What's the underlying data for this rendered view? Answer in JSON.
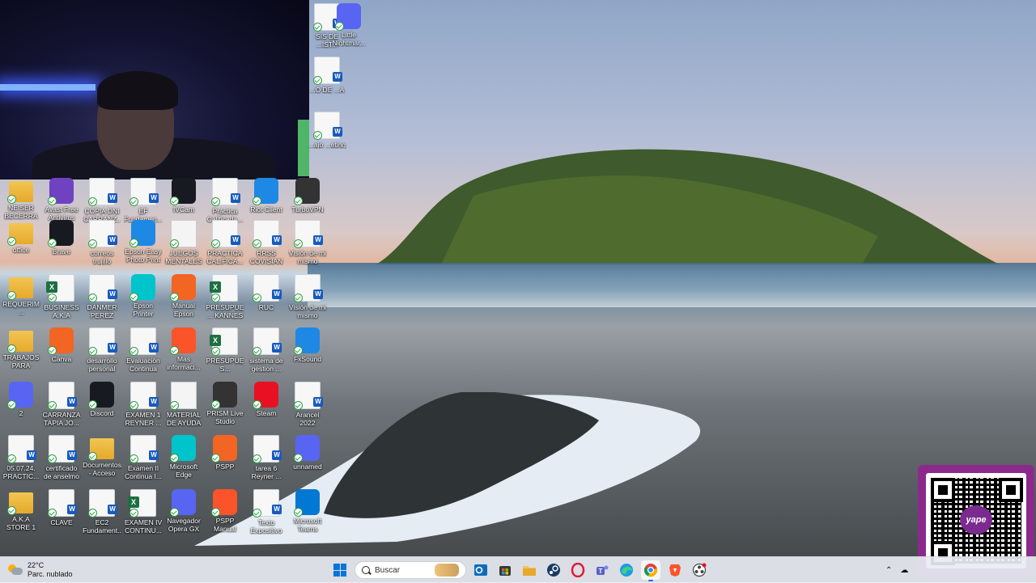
{
  "desktop": {
    "columns": [
      {
        "col": 0,
        "items": [
          {
            "label": "NEISER BECERRA C...",
            "type": "folder"
          },
          {
            "label": "office",
            "type": "folder"
          },
          {
            "label": "REQUERIM... TRUJILLO",
            "type": "folder"
          },
          {
            "label": "TRABAJOS PARA POW...",
            "type": "folder"
          },
          {
            "label": "2",
            "type": "app"
          },
          {
            "label": "05.07.24. PRACTIC...",
            "type": "doc"
          },
          {
            "label": "A.K.A STORE 1",
            "type": "folder"
          }
        ]
      },
      {
        "col": 1,
        "items": [
          {
            "label": "Avast Free Antivirus",
            "type": "app"
          },
          {
            "label": "Brave",
            "type": "app"
          },
          {
            "label": "BUSINESS A.K.A",
            "type": "xls"
          },
          {
            "label": "Canva",
            "type": "app"
          },
          {
            "label": "CARRANZA TAPIA JO...",
            "type": "doc"
          },
          {
            "label": "certificado de anselmo",
            "type": "doc"
          },
          {
            "label": "CLAVE",
            "type": "doc"
          }
        ]
      },
      {
        "col": 2,
        "items": [
          {
            "label": "COPIA DNI CARRANZ...",
            "type": "doc"
          },
          {
            "label": "correos trujillo",
            "type": "doc"
          },
          {
            "label": "DANMER PEREZ CA...",
            "type": "doc"
          },
          {
            "label": "desarrollo personal",
            "type": "doc"
          },
          {
            "label": "Discord",
            "type": "app"
          },
          {
            "label": "Documentos - Acceso di...",
            "type": "folder"
          },
          {
            "label": "EC2 Fundament...",
            "type": "doc"
          }
        ]
      },
      {
        "col": 3,
        "items": [
          {
            "label": "EF Fundamen...",
            "type": "doc"
          },
          {
            "label": "Epson Easy Photo Print",
            "type": "app"
          },
          {
            "label": "Epson Printer Connectio...",
            "type": "app"
          },
          {
            "label": "Evaluación Continua 1...",
            "type": "doc"
          },
          {
            "label": "EXAMEN 1 REYNER ...",
            "type": "doc"
          },
          {
            "label": "Examen II Continua I...",
            "type": "doc"
          },
          {
            "label": "EXAMEN IV CONTINU...",
            "type": "xls"
          }
        ]
      },
      {
        "col": 4,
        "items": [
          {
            "label": "IVCam",
            "type": "app"
          },
          {
            "label": "JUEGOS MENTALES",
            "type": "blank"
          },
          {
            "label": "Manual Epson L3110",
            "type": "app"
          },
          {
            "label": "Mas informaci...",
            "type": "app"
          },
          {
            "label": "MATERIAL DE AYUDA PPT",
            "type": "blank"
          },
          {
            "label": "Microsoft Edge",
            "type": "app"
          },
          {
            "label": "Navegador Opera GX",
            "type": "app"
          }
        ]
      },
      {
        "col": 5,
        "items": [
          {
            "label": "Práctica Calificada...",
            "type": "doc"
          },
          {
            "label": "PRACTICA CALIFICA...",
            "type": "doc"
          },
          {
            "label": "PRESUPUE... KANNES 2...",
            "type": "xls"
          },
          {
            "label": "PRESUPUES... PROYECTO ...",
            "type": "xls"
          },
          {
            "label": "PRISM Live Studio",
            "type": "app"
          },
          {
            "label": "PSPP",
            "type": "app"
          },
          {
            "label": "PSPP Manual",
            "type": "app"
          }
        ]
      },
      {
        "col": 6,
        "items": [
          {
            "label": "Riot Client",
            "type": "app"
          },
          {
            "label": "RRSS COVISIAN",
            "type": "doc"
          },
          {
            "label": "RUC",
            "type": "doc"
          },
          {
            "label": "sistema de gestion ...",
            "type": "doc"
          },
          {
            "label": "Steam",
            "type": "app"
          },
          {
            "label": "tarea 6 Reyner ...",
            "type": "doc"
          },
          {
            "label": "Texto Expositivo (...",
            "type": "doc"
          }
        ]
      },
      {
        "col": 7,
        "items": [
          {
            "label": "TurboVPN",
            "type": "app"
          },
          {
            "label": "Visión de mi mismo",
            "type": "doc"
          },
          {
            "label": "Visión de mi mismo",
            "type": "doc"
          },
          {
            "label": "FxSound",
            "type": "app"
          },
          {
            "label": "Arancel 2022",
            "type": "doc"
          },
          {
            "label": "unnamed",
            "type": "app"
          },
          {
            "label": "Microsoft Teams (PWA)",
            "type": "app"
          }
        ]
      }
    ],
    "top_right": [
      {
        "label": "SIS DE ...IST...",
        "type": "doc"
      },
      {
        "label": "Little Nightmar...",
        "type": "app"
      },
      {
        "label": "...O DE ...A",
        "type": "doc"
      },
      {
        "label": "...ajo ...eting",
        "type": "doc"
      }
    ]
  },
  "qr": {
    "brand": "yape"
  },
  "taskbar": {
    "weather": {
      "temp": "22°C",
      "desc": "Parc. nublado"
    },
    "search_placeholder": "Buscar",
    "apps": [
      "outlook-icon",
      "store-icon",
      "file-explorer-icon",
      "steam-icon",
      "opera-icon",
      "teams-icon",
      "edge-icon",
      "chrome-icon",
      "brave-icon",
      "obs-icon"
    ]
  }
}
